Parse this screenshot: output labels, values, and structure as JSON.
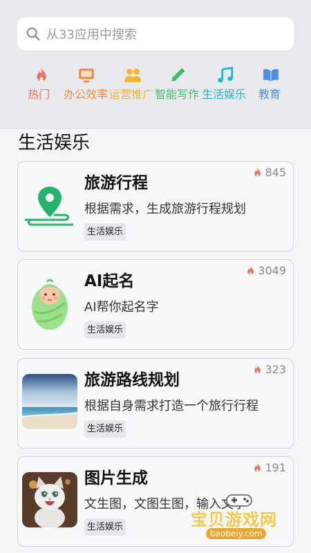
{
  "search": {
    "placeholder": "从33应用中搜索"
  },
  "categories": [
    {
      "label": "热门",
      "icon": "fire-icon",
      "color": "#f26b5b"
    },
    {
      "label": "办公效率",
      "icon": "monitor-icon",
      "color": "#f28c3a"
    },
    {
      "label": "运营推广",
      "icon": "users-icon",
      "color": "#f4b42c"
    },
    {
      "label": "智能写作",
      "icon": "pencil-icon",
      "color": "#3fc06a"
    },
    {
      "label": "生活娱乐",
      "icon": "music-icon",
      "color": "#21b8c8"
    },
    {
      "label": "教育",
      "icon": "book-icon",
      "color": "#4c8fe8"
    }
  ],
  "section": {
    "title": "生活娱乐"
  },
  "apps": [
    {
      "title": "旅游行程",
      "desc": "根据需求，生成旅游行程规划",
      "tag": "生活娱乐",
      "hot": "845",
      "thumb": "map-pin-icon"
    },
    {
      "title": "AI起名",
      "desc": "AI帮你起名字",
      "tag": "生活娱乐",
      "hot": "3049",
      "thumb": "baby-icon"
    },
    {
      "title": "旅游路线规划",
      "desc": "根据自身需求打造一个旅行行程",
      "tag": "生活娱乐",
      "hot": "323",
      "thumb": "beach-photo"
    },
    {
      "title": "图片生成",
      "desc": "文生图，文图生图，输入文字",
      "tag": "生活娱乐",
      "hot": "191",
      "thumb": "cat-photo"
    }
  ],
  "watermark": {
    "text": "宝贝游戏网",
    "url": "baobeiy.com"
  }
}
